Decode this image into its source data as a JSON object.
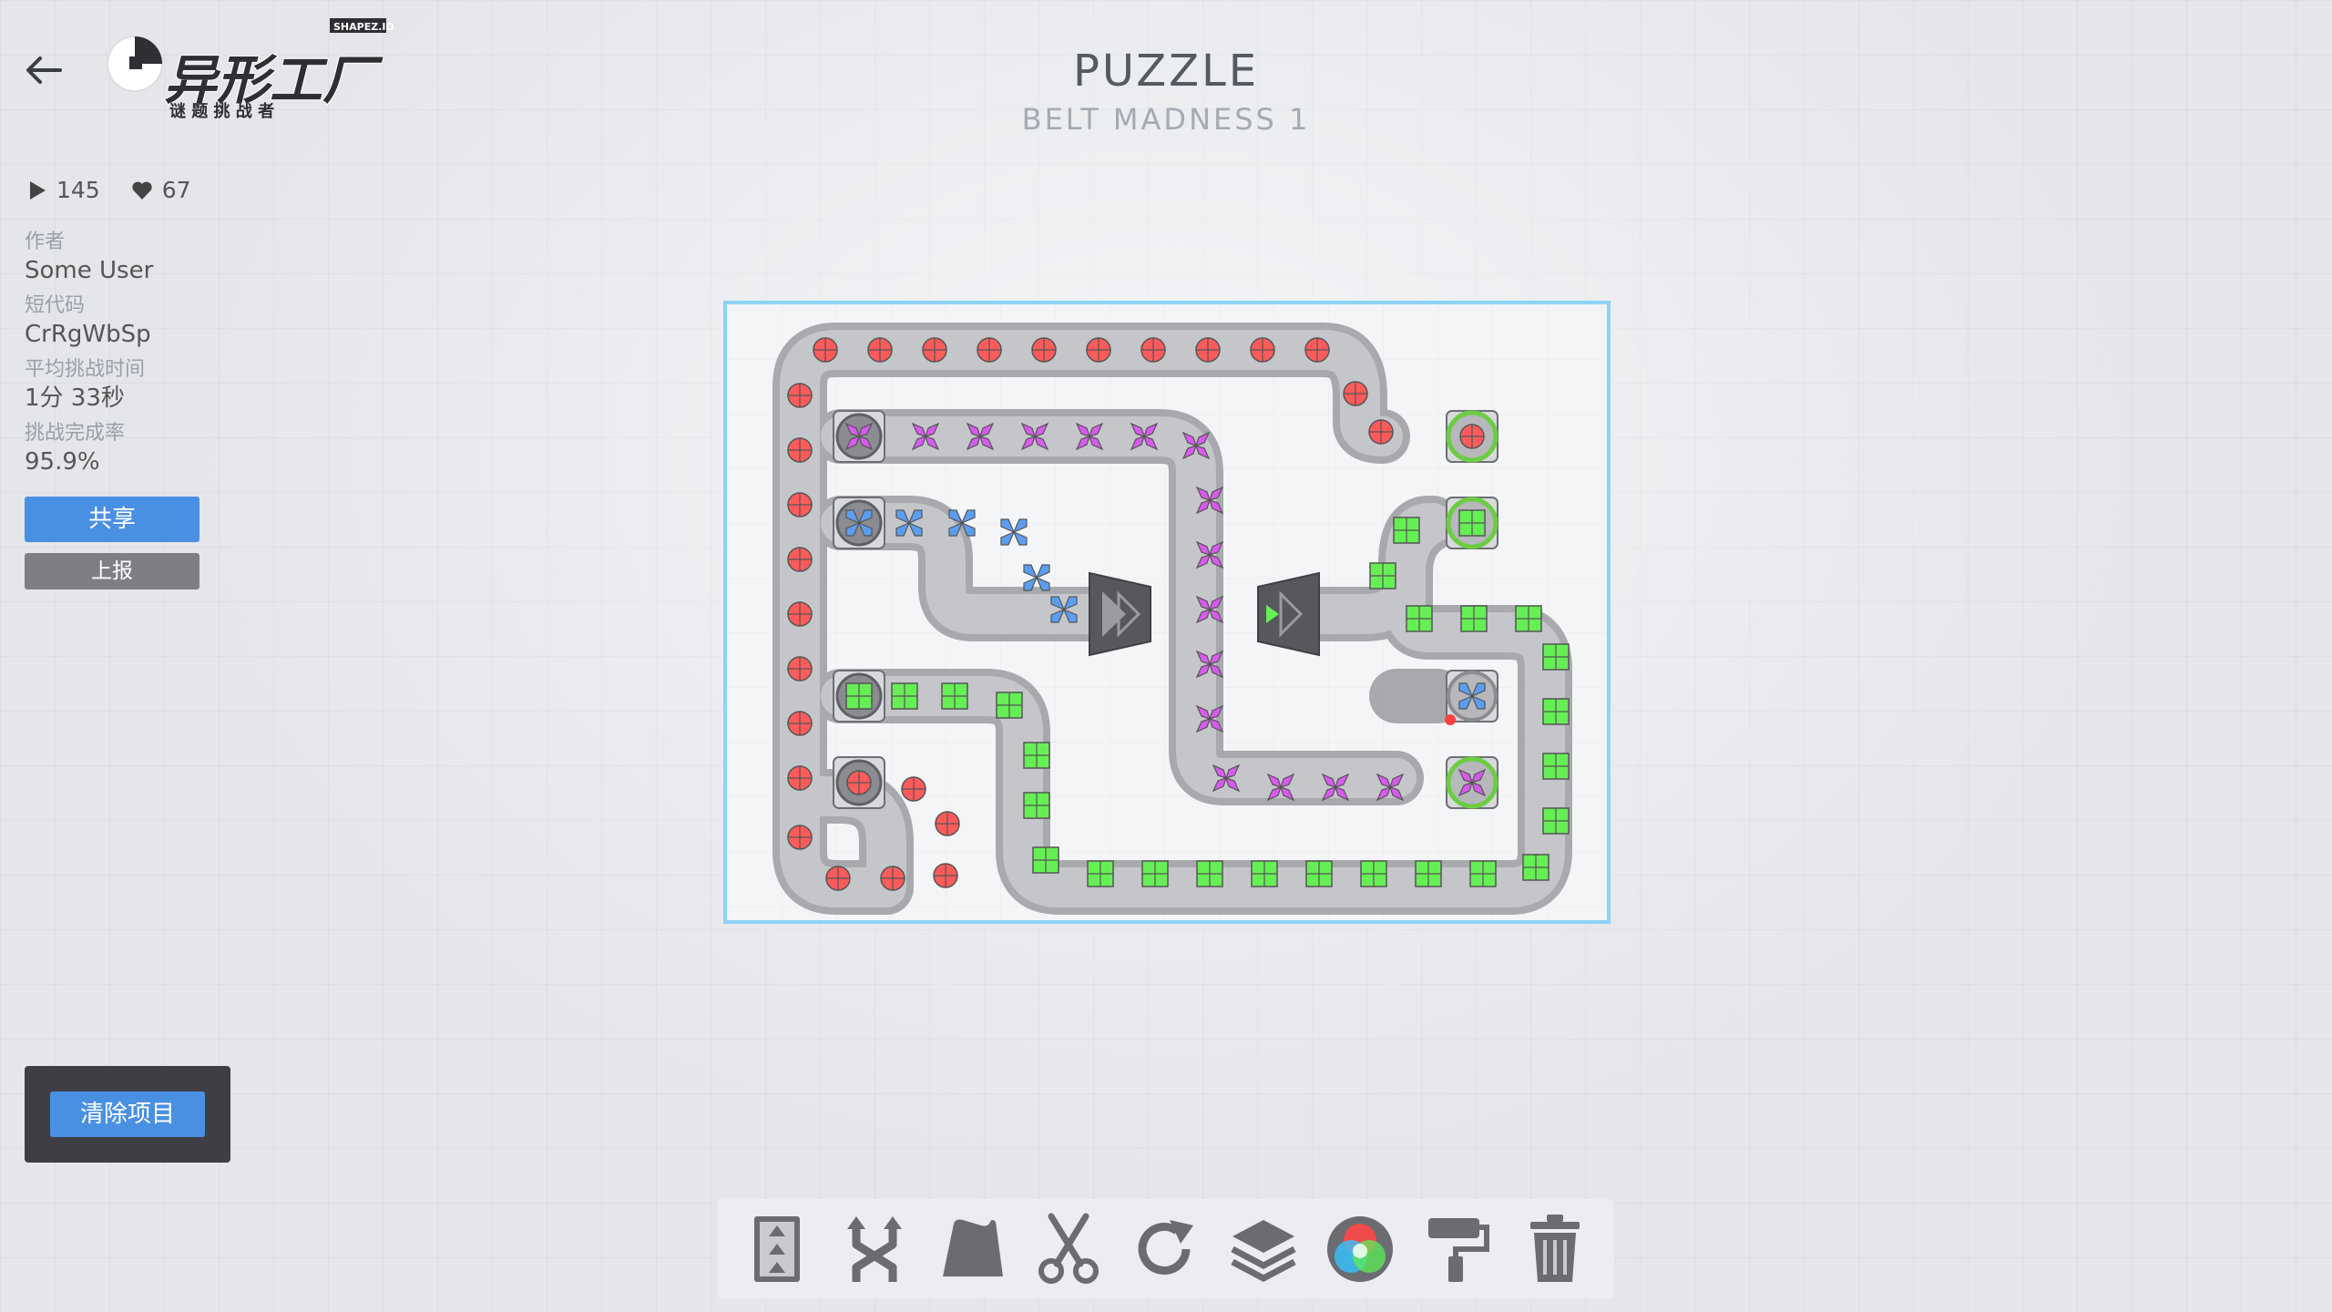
{
  "header": {
    "title": "PUZZLE",
    "subtitle": "BELT MADNESS 1"
  },
  "logo": {
    "badge": "SHAPEZ.IO",
    "main": "异形工厂",
    "tagline": "谜 题 挑 战 者"
  },
  "stats": {
    "plays": "145",
    "likes": "67"
  },
  "meta": {
    "author_label": "作者",
    "author": "Some User",
    "shortcode_label": "短代码",
    "shortcode": "CrRgWbSp",
    "avg_time_label": "平均挑战时间",
    "avg_time": "1分 33秒",
    "completion_label": "挑战完成率",
    "completion": "95.9%"
  },
  "buttons": {
    "share": "共享",
    "report": "上报",
    "clear_items": "清除项目"
  },
  "toolbar": {
    "tools": [
      "belt-icon",
      "balancer-icon",
      "tunnel-icon",
      "cutter-icon",
      "rotator-icon",
      "stacker-icon",
      "mixer-icon",
      "painter-icon",
      "trash-icon"
    ]
  },
  "colors": {
    "accent_blue": "#4a90e2",
    "board_border": "#8fd2f5",
    "shape_red": "#ff5b5b",
    "shape_green": "#66ef55",
    "shape_blue": "#5b9ef0",
    "shape_purple": "#d95af0",
    "goal_ring": "#6ccd43"
  }
}
